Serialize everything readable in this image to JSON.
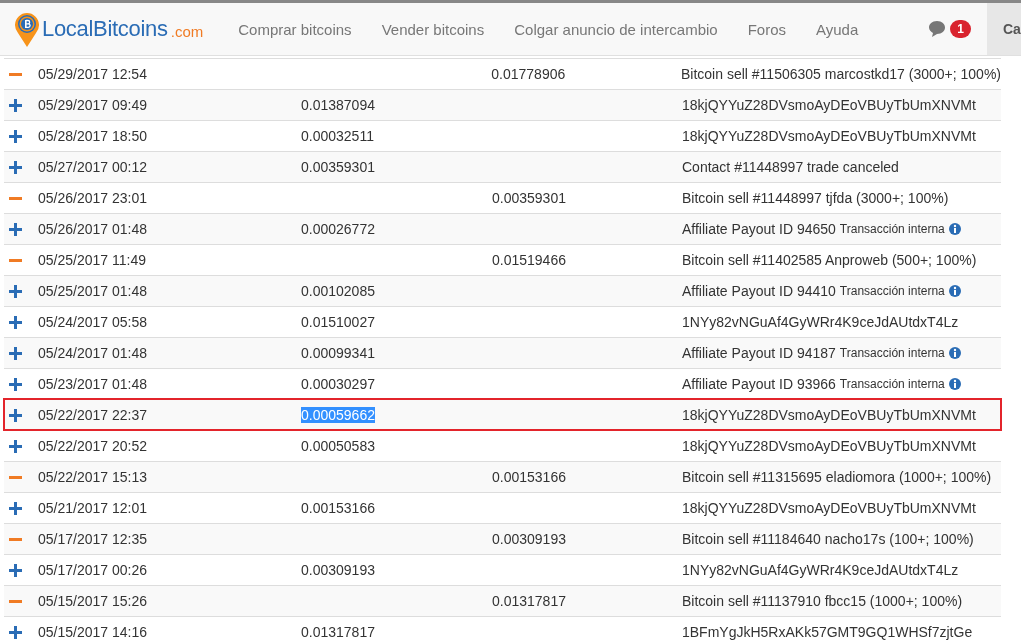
{
  "header": {
    "logo": {
      "name": "LocalBitcoins",
      "suffix": ".com"
    },
    "nav": [
      "Comprar bitcoins",
      "Vender bitcoins",
      "Colgar anuncio de intercambio",
      "Foros",
      "Ayuda"
    ],
    "messages_badge": "1",
    "cut_tab": "Ca"
  },
  "transactions": [
    {
      "kind": "out",
      "date": "05/29/2017 12:54",
      "sent": "0.01778906",
      "description": "Bitcoin sell #11506305 marcostkd17 (3000+; 100%)",
      "outlined": false
    },
    {
      "kind": "in",
      "date": "05/29/2017 09:49",
      "received": "0.01387094",
      "description": "18kjQYYuZ28DVsmoAyDEoVBUyTbUmXNVMt",
      "outlined": false,
      "amount_selected": false
    },
    {
      "kind": "in",
      "date": "05/28/2017 18:50",
      "received": "0.00032511",
      "description": "18kjQYYuZ28DVsmoAyDEoVBUyTbUmXNVMt",
      "outlined": false,
      "amount_selected": false
    },
    {
      "kind": "in",
      "date": "05/27/2017 00:12",
      "received": "0.00359301",
      "description": "Contact #11448997 trade canceled",
      "outlined": false,
      "amount_selected": false
    },
    {
      "kind": "out",
      "date": "05/26/2017 23:01",
      "sent": "0.00359301",
      "description": "Bitcoin sell #11448997 tjfda (3000+; 100%)",
      "outlined": false
    },
    {
      "kind": "in",
      "date": "05/26/2017 01:48",
      "received": "0.00026772",
      "description": "Affiliate Payout ID 94650",
      "note": "Transacción interna",
      "outlined": false,
      "amount_selected": false
    },
    {
      "kind": "out",
      "date": "05/25/2017 11:49",
      "sent": "0.01519466",
      "description": "Bitcoin sell #11402585 Anproweb (500+; 100%)",
      "outlined": false
    },
    {
      "kind": "in",
      "date": "05/25/2017 01:48",
      "received": "0.00102085",
      "description": "Affiliate Payout ID 94410",
      "note": "Transacción interna",
      "outlined": false,
      "amount_selected": false
    },
    {
      "kind": "in",
      "date": "05/24/2017 05:58",
      "received": "0.01510027",
      "description": "1NYy82vNGuAf4GyWRr4K9ceJdAUtdxT4Lz",
      "outlined": false,
      "amount_selected": false
    },
    {
      "kind": "in",
      "date": "05/24/2017 01:48",
      "received": "0.00099341",
      "description": "Affiliate Payout ID 94187",
      "note": "Transacción interna",
      "outlined": false,
      "amount_selected": false
    },
    {
      "kind": "in",
      "date": "05/23/2017 01:48",
      "received": "0.00030297",
      "description": "Affiliate Payout ID 93966",
      "note": "Transacción interna",
      "outlined": false,
      "amount_selected": false
    },
    {
      "kind": "in",
      "date": "05/22/2017 22:37",
      "received": "0.00059662",
      "description": "18kjQYYuZ28DVsmoAyDEoVBUyTbUmXNVMt",
      "outlined": true,
      "amount_selected": true
    },
    {
      "kind": "in",
      "date": "05/22/2017 20:52",
      "received": "0.00050583",
      "description": "18kjQYYuZ28DVsmoAyDEoVBUyTbUmXNVMt",
      "outlined": false,
      "amount_selected": false
    },
    {
      "kind": "out",
      "date": "05/22/2017 15:13",
      "sent": "0.00153166",
      "description": "Bitcoin sell #11315695 eladiomora (1000+; 100%)",
      "outlined": false
    },
    {
      "kind": "in",
      "date": "05/21/2017 12:01",
      "received": "0.00153166",
      "description": "18kjQYYuZ28DVsmoAyDEoVBUyTbUmXNVMt",
      "outlined": false,
      "amount_selected": false
    },
    {
      "kind": "out",
      "date": "05/17/2017 12:35",
      "sent": "0.00309193",
      "description": "Bitcoin sell #11184640 nacho17s (100+; 100%)",
      "outlined": false
    },
    {
      "kind": "in",
      "date": "05/17/2017 00:26",
      "received": "0.00309193",
      "description": "1NYy82vNGuAf4GyWRr4K9ceJdAUtdxT4Lz",
      "outlined": false,
      "amount_selected": false
    },
    {
      "kind": "out",
      "date": "05/15/2017 15:26",
      "sent": "0.01317817",
      "description": "Bitcoin sell #11137910 fbcc15 (1000+; 100%)",
      "outlined": false
    },
    {
      "kind": "in",
      "date": "05/15/2017 14:16",
      "received": "0.01317817",
      "description": "1BFmYgJkH5RxAKk57GMT9GQ1WHSf7zjtGe",
      "outlined": false,
      "amount_selected": false
    }
  ]
}
